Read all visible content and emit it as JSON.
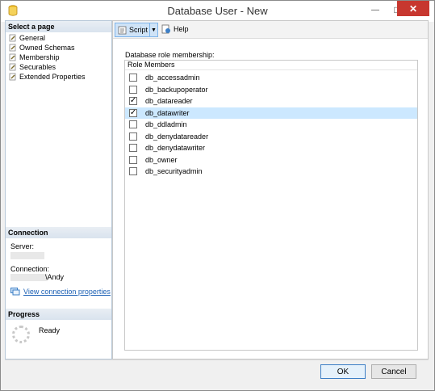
{
  "window": {
    "title": "Database User - New"
  },
  "titlebar": {
    "close_label": "✕",
    "minimize_label": "—",
    "maximize_label": "□"
  },
  "left": {
    "select_page_header": "Select a page",
    "pages": [
      {
        "label": "General"
      },
      {
        "label": "Owned Schemas"
      },
      {
        "label": "Membership"
      },
      {
        "label": "Securables"
      },
      {
        "label": "Extended Properties"
      }
    ],
    "connection_header": "Connection",
    "server_label": "Server:",
    "connection_label": "Connection:",
    "connection_user": "\\Andy",
    "view_connection_link": "View connection properties",
    "progress_header": "Progress",
    "progress_status": "Ready"
  },
  "toolbar": {
    "script_label": "Script",
    "help_label": "Help"
  },
  "roles": {
    "caption": "Database role membership:",
    "column_header": "Role Members",
    "items": [
      {
        "name": "db_accessadmin",
        "checked": false
      },
      {
        "name": "db_backupoperator",
        "checked": false
      },
      {
        "name": "db_datareader",
        "checked": true
      },
      {
        "name": "db_datawriter",
        "checked": true
      },
      {
        "name": "db_ddladmin",
        "checked": false
      },
      {
        "name": "db_denydatareader",
        "checked": false
      },
      {
        "name": "db_denydatawriter",
        "checked": false
      },
      {
        "name": "db_owner",
        "checked": false
      },
      {
        "name": "db_securityadmin",
        "checked": false
      }
    ],
    "selected_index": 3
  },
  "buttons": {
    "ok_label": "OK",
    "cancel_label": "Cancel"
  }
}
